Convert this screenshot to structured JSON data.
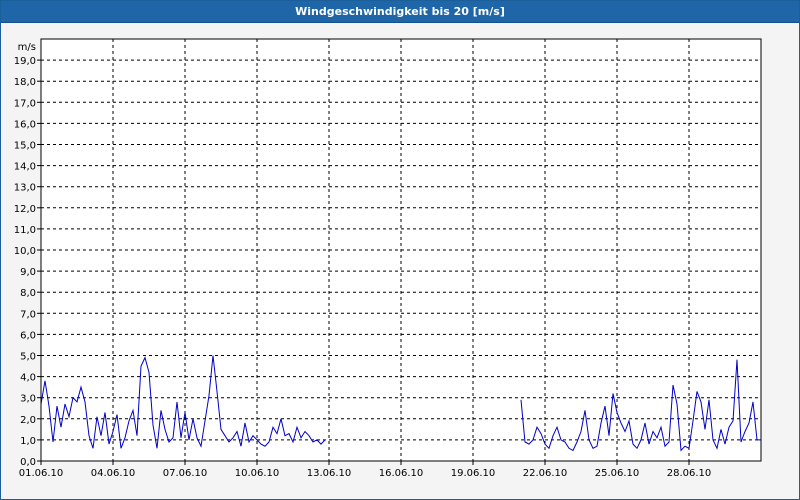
{
  "window": {
    "title": "Windgeschwindigkeit bis 20 [m/s]"
  },
  "chart_data": {
    "type": "line",
    "title": "Windgeschwindigkeit bis 20 [m/s]",
    "ylabel": "m/s",
    "xlabel": "",
    "x_unit": "date (day of June 2010, 01.06.10 = 0)",
    "xlim": [
      "01.06.10",
      "01.07.10"
    ],
    "ylim": [
      0,
      20
    ],
    "grid": true,
    "legend": "none",
    "series_color": "#0000c8",
    "y_ticks": [
      "0,0",
      "1,0",
      "2,0",
      "3,0",
      "4,0",
      "5,0",
      "6,0",
      "7,0",
      "8,0",
      "9,0",
      "10,0",
      "11,0",
      "12,0",
      "13,0",
      "14,0",
      "15,0",
      "16,0",
      "17,0",
      "18,0",
      "19,0"
    ],
    "x_ticks": [
      "01.06.10",
      "04.06.10",
      "07.06.10",
      "10.06.10",
      "13.06.10",
      "16.06.10",
      "19.06.10",
      "22.06.10",
      "25.06.10",
      "28.06.10"
    ],
    "segments": [
      {
        "x": [
          "01.06.10 00:00",
          "01.06.10 04:00",
          "01.06.10 08:00",
          "01.06.10 12:00",
          "01.06.10 16:00",
          "01.06.10 20:00",
          "02.06.10 00:00",
          "02.06.10 04:00",
          "02.06.10 08:00",
          "02.06.10 12:00",
          "02.06.10 16:00",
          "02.06.10 20:00",
          "03.06.10 00:00",
          "03.06.10 04:00",
          "03.06.10 08:00",
          "03.06.10 12:00",
          "03.06.10 16:00",
          "03.06.10 20:00",
          "04.06.10 00:00",
          "04.06.10 04:00",
          "04.06.10 08:00",
          "04.06.10 12:00",
          "04.06.10 16:00",
          "04.06.10 20:00",
          "05.06.10 00:00",
          "05.06.10 04:00",
          "05.06.10 08:00",
          "05.06.10 12:00",
          "05.06.10 16:00",
          "05.06.10 20:00",
          "06.06.10 00:00",
          "06.06.10 04:00",
          "06.06.10 08:00",
          "06.06.10 12:00",
          "06.06.10 16:00",
          "06.06.10 20:00",
          "07.06.10 00:00",
          "07.06.10 04:00",
          "07.06.10 08:00",
          "07.06.10 12:00",
          "07.06.10 16:00",
          "07.06.10 20:00",
          "08.06.10 00:00",
          "08.06.10 04:00",
          "08.06.10 08:00",
          "08.06.10 12:00",
          "08.06.10 16:00",
          "08.06.10 20:00",
          "09.06.10 00:00",
          "09.06.10 04:00",
          "09.06.10 08:00",
          "09.06.10 12:00",
          "09.06.10 16:00",
          "09.06.10 20:00",
          "10.06.10 00:00",
          "10.06.10 04:00",
          "10.06.10 08:00",
          "10.06.10 12:00",
          "10.06.10 16:00",
          "10.06.10 20:00",
          "11.06.10 00:00",
          "11.06.10 04:00",
          "11.06.10 08:00",
          "11.06.10 12:00",
          "11.06.10 16:00",
          "11.06.10 20:00",
          "12.06.10 00:00",
          "12.06.10 04:00",
          "12.06.10 08:00",
          "12.06.10 12:00",
          "12.06.10 16:00",
          "12.06.10 20:00"
        ],
        "y": [
          2.7,
          3.8,
          2.6,
          0.9,
          2.6,
          1.6,
          2.7,
          2.1,
          3.0,
          2.8,
          3.5,
          2.8,
          1.2,
          0.6,
          2.1,
          1.2,
          2.3,
          0.8,
          1.4,
          2.2,
          0.6,
          1.1,
          1.9,
          2.4,
          1.2,
          4.5,
          4.9,
          4.2,
          1.7,
          0.6,
          2.4,
          1.5,
          0.9,
          1.1,
          2.8,
          1.1,
          2.3,
          1.0,
          2.0,
          1.1,
          0.7,
          1.9,
          3.1,
          5.0,
          3.3,
          1.5,
          1.2,
          0.9,
          1.1,
          1.4,
          0.7,
          1.8,
          0.9,
          1.2,
          1.0,
          0.8,
          0.7,
          0.9,
          1.6,
          1.3,
          2.0,
          1.2,
          1.3,
          0.9,
          1.6,
          1.1,
          1.4,
          1.2,
          0.9,
          1.0,
          0.8,
          1.0
        ]
      },
      {
        "x": [
          "21.06.10 00:00",
          "21.06.10 04:00",
          "21.06.10 08:00",
          "21.06.10 12:00",
          "21.06.10 16:00",
          "21.06.10 20:00",
          "22.06.10 00:00",
          "22.06.10 04:00",
          "22.06.10 08:00",
          "22.06.10 12:00",
          "22.06.10 16:00",
          "22.06.10 20:00",
          "23.06.10 00:00",
          "23.06.10 04:00",
          "23.06.10 08:00",
          "23.06.10 12:00",
          "23.06.10 16:00",
          "23.06.10 20:00",
          "24.06.10 00:00",
          "24.06.10 04:00",
          "24.06.10 08:00",
          "24.06.10 12:00",
          "24.06.10 16:00",
          "24.06.10 20:00",
          "25.06.10 00:00",
          "25.06.10 04:00",
          "25.06.10 08:00",
          "25.06.10 12:00",
          "25.06.10 16:00",
          "25.06.10 20:00",
          "26.06.10 00:00",
          "26.06.10 04:00",
          "26.06.10 08:00",
          "26.06.10 12:00",
          "26.06.10 16:00",
          "26.06.10 20:00",
          "27.06.10 00:00",
          "27.06.10 04:00",
          "27.06.10 08:00",
          "27.06.10 12:00",
          "27.06.10 16:00",
          "27.06.10 20:00",
          "28.06.10 00:00",
          "28.06.10 04:00",
          "28.06.10 08:00",
          "28.06.10 12:00",
          "28.06.10 16:00",
          "28.06.10 20:00",
          "29.06.10 00:00",
          "29.06.10 04:00",
          "29.06.10 08:00",
          "29.06.10 12:00",
          "29.06.10 16:00",
          "29.06.10 20:00",
          "30.06.10 00:00",
          "30.06.10 04:00",
          "30.06.10 08:00",
          "30.06.10 12:00",
          "30.06.10 16:00",
          "30.06.10 20:00",
          "01.07.10 00:00"
        ],
        "y": [
          2.9,
          0.9,
          0.8,
          1.0,
          1.6,
          1.3,
          0.8,
          0.6,
          1.2,
          1.6,
          1.0,
          0.9,
          0.6,
          0.5,
          0.9,
          1.4,
          2.4,
          1.0,
          0.6,
          0.7,
          1.8,
          2.6,
          1.2,
          3.2,
          2.3,
          1.8,
          1.4,
          1.9,
          0.8,
          0.6,
          1.0,
          1.8,
          0.8,
          1.4,
          1.1,
          1.6,
          0.7,
          0.9,
          3.6,
          2.7,
          0.5,
          0.7,
          0.6,
          1.9,
          3.3,
          2.8,
          1.5,
          2.9,
          1.0,
          0.6,
          1.5,
          0.8,
          1.6,
          1.9,
          4.8,
          0.9,
          1.4,
          1.8,
          2.8,
          1.0,
          1.0
        ]
      }
    ]
  }
}
